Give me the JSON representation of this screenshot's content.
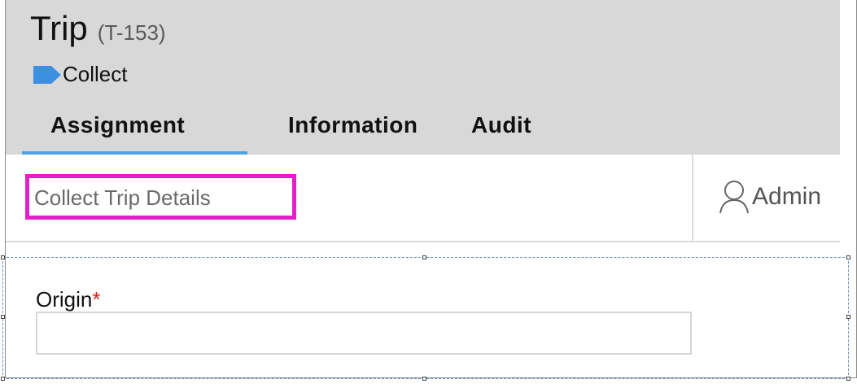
{
  "header": {
    "title": "Trip",
    "record_id": "(T-153)",
    "status": {
      "label": "Collect",
      "icon": "tag-arrow-icon",
      "color": "#3d8fe0"
    }
  },
  "tabs": [
    {
      "label": "Assignment",
      "active": true
    },
    {
      "label": "Information",
      "active": false
    },
    {
      "label": "Audit",
      "active": false
    }
  ],
  "accent_color": "#4fa3e3",
  "highlight_color": "#e020c8",
  "step": {
    "label": "Collect Trip Details"
  },
  "assignee": {
    "label": "Admin",
    "icon": "user-icon"
  },
  "form": {
    "fields": [
      {
        "label": "Origin",
        "required_marker": "*",
        "value": ""
      }
    ]
  }
}
